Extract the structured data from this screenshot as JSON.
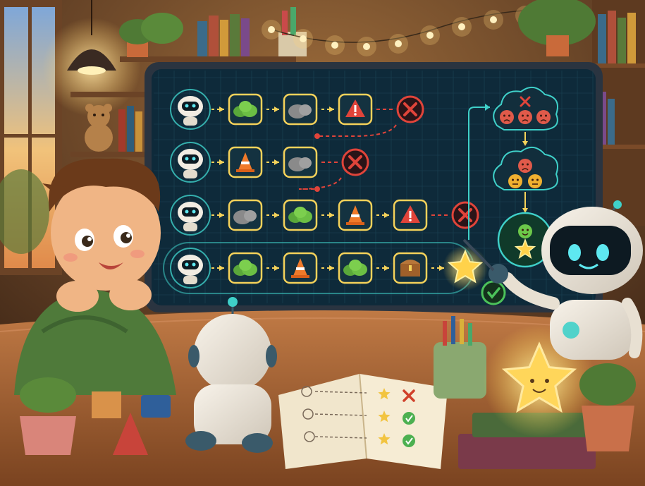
{
  "scene": {
    "palette": {
      "wall": "#5a3a22",
      "lamp_glow": "#ffd27a",
      "screen_bg": "#0e2a3a",
      "grid_line": "#1c4556",
      "neon_teal": "#3fd0c9",
      "neon_yellow": "#f5d25a",
      "fail_red": "#e0443a",
      "success_green": "#4cc25a",
      "desk": "#a8663a"
    }
  },
  "screen": {
    "paths": [
      {
        "id": "row-1",
        "steps": [
          "robot-icon",
          "bush-icon",
          "rock-icon",
          "warning-icon"
        ],
        "outcome": "fail"
      },
      {
        "id": "row-2",
        "steps": [
          "robot-icon",
          "traffic-cone-icon",
          "rock-icon"
        ],
        "outcome": "fail"
      },
      {
        "id": "row-3",
        "steps": [
          "robot-icon",
          "rock-icon",
          "bush-icon",
          "traffic-cone-icon",
          "warning-icon"
        ],
        "outcome": "fail"
      },
      {
        "id": "row-4",
        "steps": [
          "robot-icon",
          "bush-icon",
          "traffic-cone-icon",
          "bush-icon",
          "treasure-chest-icon",
          "star-icon"
        ],
        "outcome": "success"
      }
    ],
    "feedback_clouds": [
      {
        "id": "cloud-sad",
        "faces": [
          "sad",
          "sad",
          "sad"
        ],
        "mark": "fail"
      },
      {
        "id": "cloud-mixed",
        "faces": [
          "sad",
          "neutral",
          "neutral"
        ],
        "mark": "none"
      },
      {
        "id": "cloud-happy",
        "faces": [
          "happy"
        ],
        "mark": "star"
      }
    ]
  },
  "notebook": {
    "rows": [
      {
        "mark": "fail"
      },
      {
        "mark": "success"
      },
      {
        "mark": "success"
      }
    ]
  }
}
